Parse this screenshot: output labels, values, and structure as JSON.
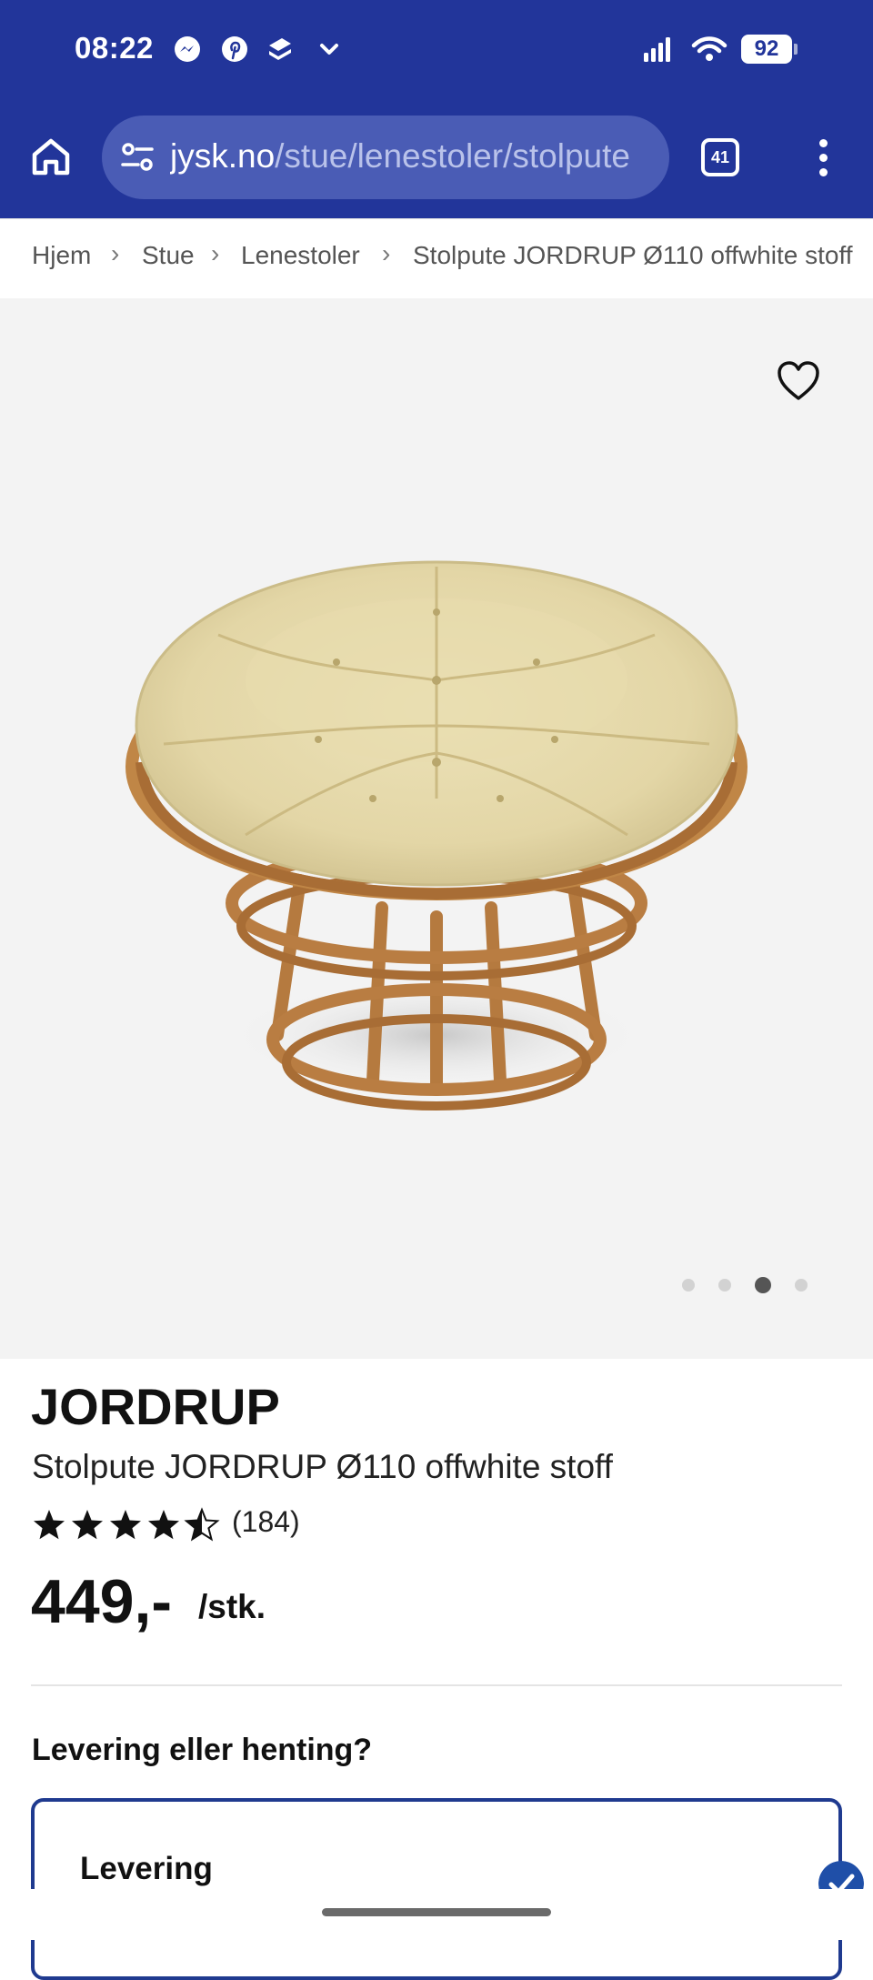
{
  "status_bar": {
    "time": "08:22",
    "notification_icons": [
      "messenger-icon",
      "pinterest-icon",
      "stack-app-icon",
      "chevron-down-icon"
    ],
    "system_icons": [
      "signal-icon",
      "wifi-icon",
      "battery-icon"
    ],
    "battery_level": "92"
  },
  "browser": {
    "url_domain": "jysk.no",
    "url_path": "/stue/lenestoler/stolpute",
    "tab_count": "41",
    "accent_color": "#22359a"
  },
  "breadcrumb": {
    "items": [
      "Hjem",
      "Stue",
      "Lenestoler",
      "Stolpute JORDRUP Ø110 offwhite stoff"
    ]
  },
  "gallery": {
    "image_count": 4,
    "active_index": 2,
    "background": "#f3f3f3"
  },
  "product": {
    "brand": "JORDRUP",
    "name": "Stolpute JORDRUP Ø110 offwhite stoff",
    "rating": 4.5,
    "max_rating": 5,
    "review_count": "(184)",
    "price": "449,-",
    "unit": "/stk."
  },
  "delivery": {
    "question": "Levering eller henting?",
    "option_label": "Levering",
    "selected_color": "#1f4fa8"
  }
}
